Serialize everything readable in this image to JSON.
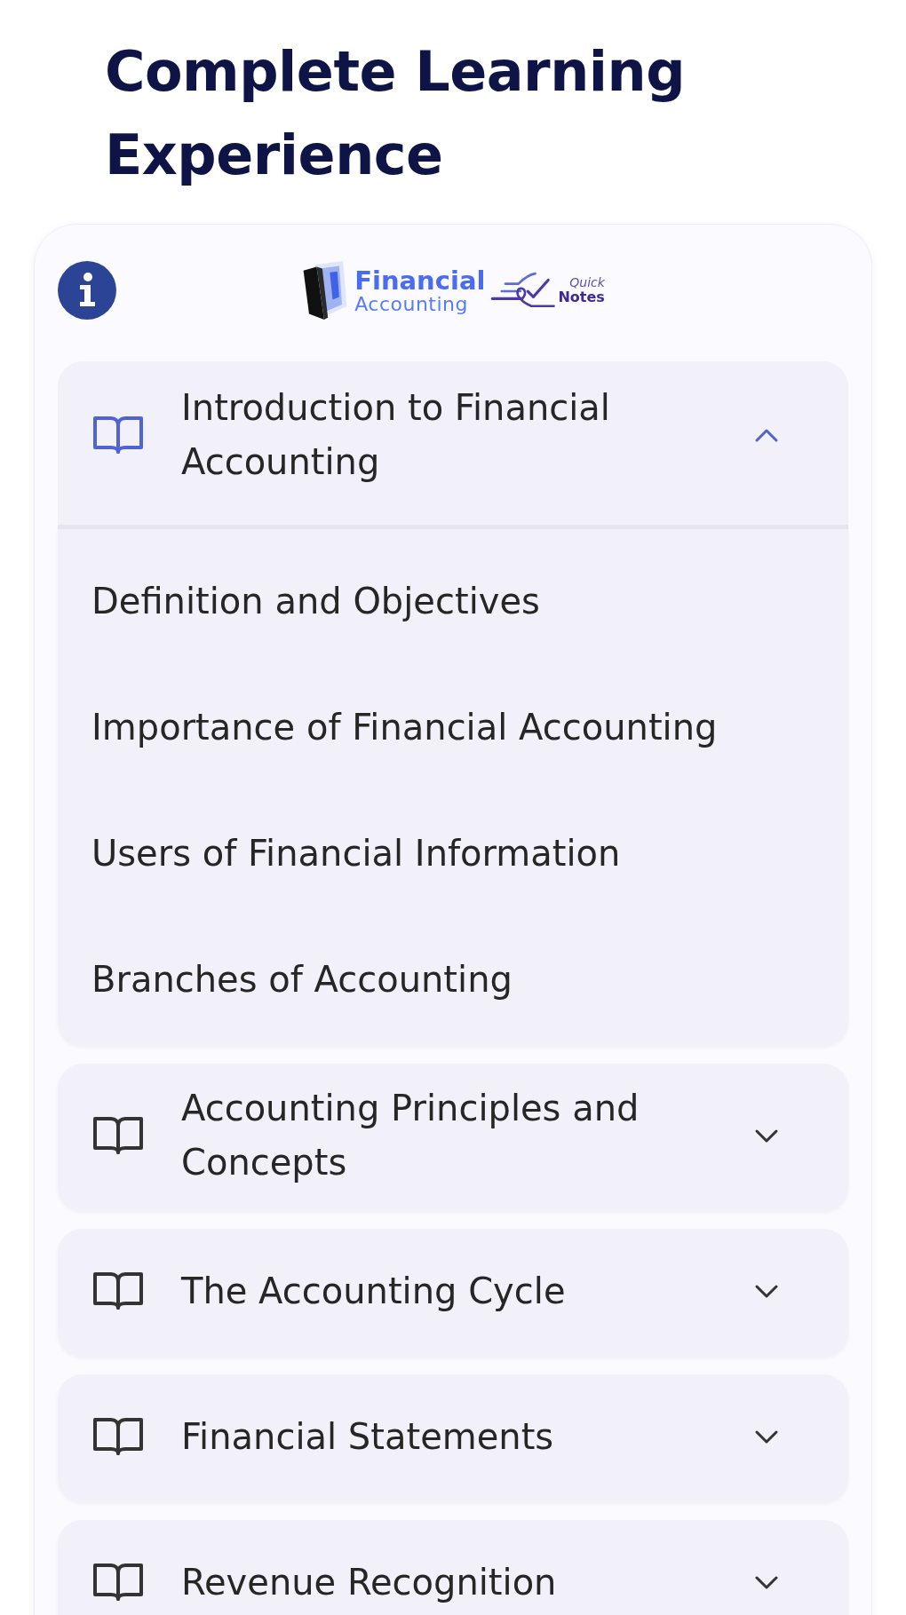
{
  "page": {
    "title": "Complete Learning Experience"
  },
  "logo": {
    "title": "Financial",
    "subtitle": "Accounting",
    "tagline_top": "Quick",
    "tagline_bottom": "Notes"
  },
  "sections": [
    {
      "title": "Introduction to Financial Accounting",
      "expanded": true,
      "children": [
        {
          "title": "Definition and Objectives"
        },
        {
          "title": "Importance of Financial Accounting"
        },
        {
          "title": "Users of Financial Information"
        },
        {
          "title": "Branches of Accounting"
        }
      ]
    },
    {
      "title": "Accounting Principles and Concepts",
      "expanded": false
    },
    {
      "title": "The Accounting Cycle",
      "expanded": false
    },
    {
      "title": "Financial Statements",
      "expanded": false
    },
    {
      "title": "Revenue Recognition",
      "expanded": false
    }
  ]
}
